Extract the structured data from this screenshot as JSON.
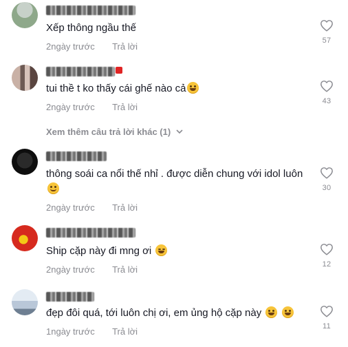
{
  "comments": [
    {
      "text": "Xếp thông ngầu thế",
      "emojis": [],
      "time": "2ngày trước",
      "reply_label": "Trả lời",
      "likes": "57",
      "avatar_colors": [
        "#8ea88a",
        "#c7d1c9"
      ]
    },
    {
      "text": "tui thề t ko thấy cái ghế nào cả",
      "emojis": [
        "grin"
      ],
      "time": "2ngày trước",
      "reply_label": "Trả lời",
      "likes": "43",
      "avatar_colors": [
        "#c9b1a6",
        "#6d5a54"
      ]
    },
    {
      "text": "thông soái ca nổi thế nhỉ . được diễn chung với idol luôn",
      "emojis": [
        "smile"
      ],
      "time": "2ngày trước",
      "reply_label": "Trả lời",
      "likes": "30",
      "avatar_colors": [
        "#0e0e0e",
        "#2a2a2a"
      ]
    },
    {
      "text": "Ship cặp này đi mng ơi",
      "emojis": [
        "squint"
      ],
      "time": "2ngày trước",
      "reply_label": "Trả lời",
      "likes": "12",
      "avatar_colors": [
        "#d62a1e",
        "#f3c916"
      ]
    },
    {
      "text": "đẹp đôi quá, tới luôn chị ơi, em ủng hộ cặp này",
      "emojis": [
        "grin",
        "grin"
      ],
      "time": "1ngày trước",
      "reply_label": "Trả lời",
      "likes": "11",
      "avatar_colors": [
        "#b9c7d8",
        "#6e7f92"
      ]
    }
  ],
  "view_more_replies": "Xem thêm câu trả lời khác (1)",
  "colors": {
    "text": "#161823",
    "secondary": "#8a8b91",
    "background": "#ffffff"
  },
  "icons": {
    "like": "heart-outline-icon",
    "expand": "chevron-down-icon"
  }
}
